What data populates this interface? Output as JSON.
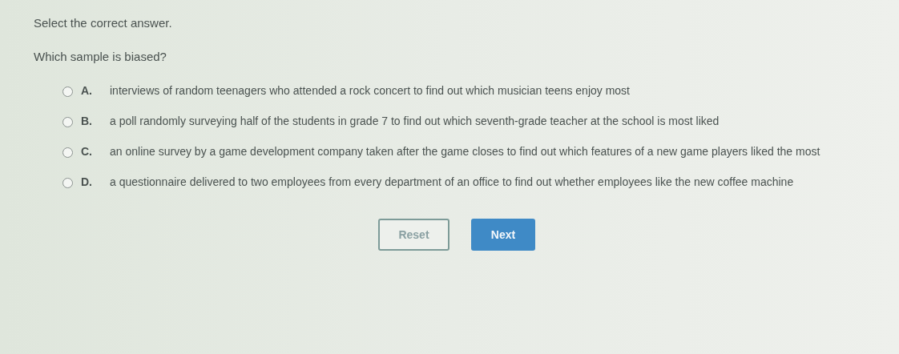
{
  "instruction": "Select the correct answer.",
  "question": "Which sample is biased?",
  "options": [
    {
      "letter": "A.",
      "text": "interviews of random teenagers who attended a rock concert to find out which musician teens enjoy most",
      "selected": false
    },
    {
      "letter": "B.",
      "text": "a poll randomly surveying half of the students in grade 7 to find out which seventh-grade teacher at the school is most liked",
      "selected": false
    },
    {
      "letter": "C.",
      "text": "an online survey by a game development company taken after the game closes to find out which features of a new game players liked the most",
      "selected": false
    },
    {
      "letter": "D.",
      "text": "a questionnaire delivered to two employees from every department of an office to find out whether employees like the new coffee machine",
      "selected": false
    }
  ],
  "buttons": [
    {
      "label": "Reset",
      "kind": "outline"
    },
    {
      "label": "Next",
      "kind": "primary"
    }
  ]
}
